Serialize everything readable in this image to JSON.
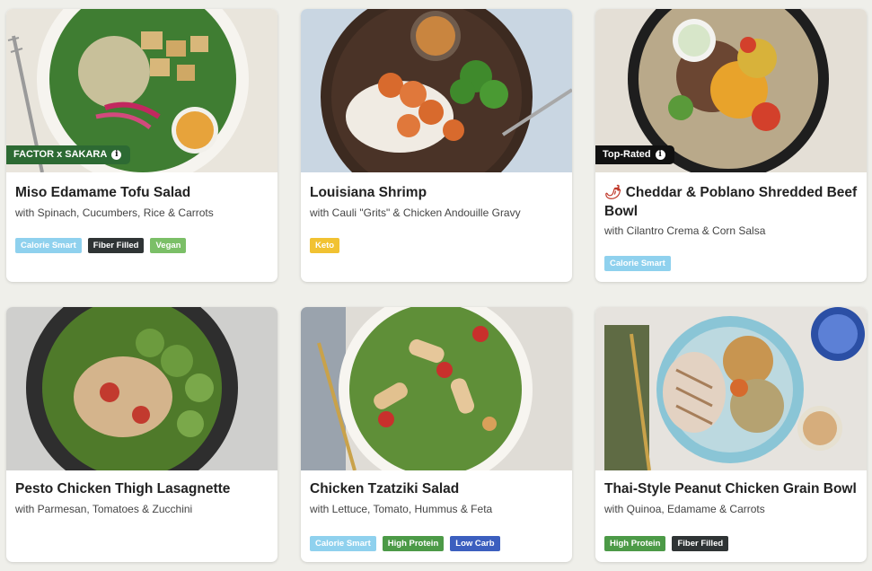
{
  "colors": {
    "calorie_smart": "#8fd1ee",
    "fiber_filled": "#2f3435",
    "vegan": "#7bbf67",
    "keto": "#f1c232",
    "high_protein": "#4c9a47",
    "low_carb": "#3c5fbf"
  },
  "meals": [
    {
      "badge": "FACTOR x SAKARA",
      "title": "Miso Edamame Tofu Salad",
      "subtitle": "with Spinach, Cucumbers, Rice & Carrots",
      "tags": [
        "Calorie Smart",
        "Fiber Filled",
        "Vegan"
      ]
    },
    {
      "badge": "",
      "title": "Louisiana Shrimp",
      "subtitle": "with Cauli \"Grits\" & Chicken Andouille Gravy",
      "tags": [
        "Keto"
      ]
    },
    {
      "badge": "Top-Rated",
      "title": "Cheddar & Poblano Shredded Beef Bowl",
      "subtitle": "with Cilantro Crema & Corn Salsa",
      "tags": [
        "Calorie Smart"
      ],
      "spicy_icon": "chili-pepper-icon"
    },
    {
      "badge": "",
      "title": "Pesto Chicken Thigh Lasagnette",
      "subtitle": "with Parmesan, Tomatoes & Zucchini",
      "tags": []
    },
    {
      "badge": "",
      "title": "Chicken Tzatziki Salad",
      "subtitle": "with Lettuce, Tomato, Hummus & Feta",
      "tags": [
        "Calorie Smart",
        "High Protein",
        "Low Carb"
      ]
    },
    {
      "badge": "",
      "title": "Thai-Style Peanut Chicken Grain Bowl",
      "subtitle": "with Quinoa, Edamame & Carrots",
      "tags": [
        "High Protein",
        "Fiber Filled"
      ]
    }
  ]
}
